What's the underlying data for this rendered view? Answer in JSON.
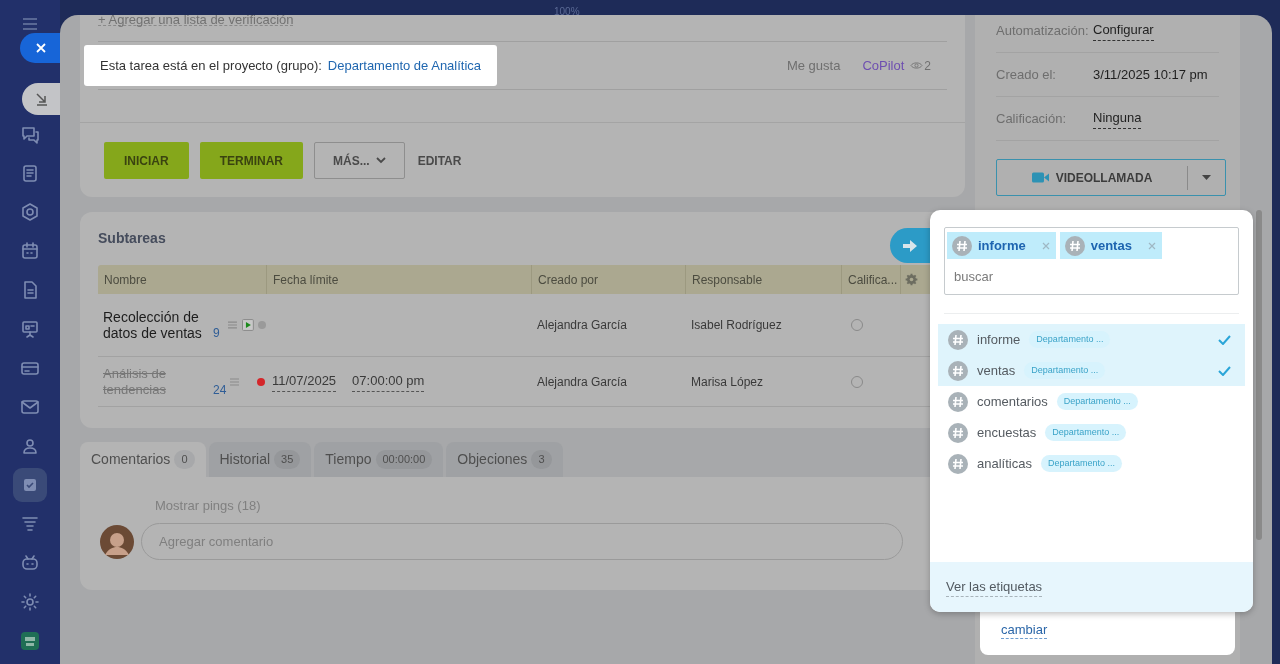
{
  "zoom_label": "100%",
  "sidebar": {
    "items": [
      {
        "selected": false
      },
      {
        "selected": false
      },
      {
        "selected": false
      },
      {
        "selected": false
      },
      {
        "selected": false
      },
      {
        "selected": false
      },
      {
        "selected": false
      },
      {
        "selected": false
      },
      {
        "selected": false
      },
      {
        "selected": true
      },
      {
        "selected": false
      },
      {
        "selected": false
      },
      {
        "selected": false
      },
      {
        "selected": false
      }
    ]
  },
  "task": {
    "checklist_link": "+ Agregar una lista de verificación",
    "project_label": "Esta tarea está en el proyecto (grupo):",
    "project_link": "Departamento de Analítica",
    "like": "Me gusta",
    "copilot": "CoPilot",
    "views": "2",
    "buttons": [
      {
        "label": "INICIAR",
        "kind": "primary"
      },
      {
        "label": "TERMINAR",
        "kind": "primary"
      },
      {
        "label": "MÁS...",
        "kind": "dropdown"
      },
      {
        "label": "EDITAR",
        "kind": "link"
      }
    ]
  },
  "details": [
    {
      "label": "Automatización:",
      "value": "Configurar",
      "kind": "link"
    },
    {
      "label": "Creado el:",
      "value": "3/11/2025 10:17 pm",
      "kind": "text"
    },
    {
      "label": "Calificación:",
      "value": "Ninguna",
      "kind": "link"
    }
  ],
  "videocall": {
    "label": "VIDEOLLAMADA"
  },
  "subtasks": {
    "title": "Subtareas",
    "columns": [
      "Nombre",
      "Fecha límite",
      "Creado por",
      "Responsable",
      "Califica..."
    ],
    "rows": [
      {
        "name": "Recolección de datos de ventas",
        "count": "9",
        "completed": false,
        "running": true,
        "overdue": false,
        "rated": false,
        "creator": "Alejandra García",
        "responsible": "Isabel Rodríguez"
      },
      {
        "name": "Análisis de tendencias",
        "count": "24",
        "completed": true,
        "running": false,
        "overdue": true,
        "rated": false,
        "deadline_date": "11/07/2025",
        "deadline_time": "07:00:00 pm",
        "creator": "Alejandra García",
        "responsible": "Marisa López"
      }
    ]
  },
  "tabs": [
    {
      "label": "Comentarios",
      "count": "0",
      "selected": true
    },
    {
      "label": "Historial",
      "count": "35",
      "selected": false
    },
    {
      "label": "Tiempo",
      "count": "00:00:00",
      "selected": false
    },
    {
      "label": "Objeciones",
      "count": "3",
      "selected": false
    }
  ],
  "comments": {
    "pings": "Mostrar pings (18)",
    "placeholder": "Agregar comentario"
  },
  "tags_card": {
    "change": "cambiar"
  },
  "tags_popup": {
    "chips": [
      {
        "label": "informe"
      },
      {
        "label": "ventas"
      }
    ],
    "search_placeholder": "buscar",
    "items": [
      {
        "name": "informe",
        "group": "Departamento ...",
        "selected": true
      },
      {
        "name": "ventas",
        "group": "Departamento ...",
        "selected": true
      },
      {
        "name": "comentarios",
        "group": "Departamento ...",
        "selected": false
      },
      {
        "name": "encuestas",
        "group": "Departamento ...",
        "selected": false
      },
      {
        "name": "analíticas",
        "group": "Departamento ...",
        "selected": false
      }
    ],
    "footer": "Ver las etiquetas"
  }
}
